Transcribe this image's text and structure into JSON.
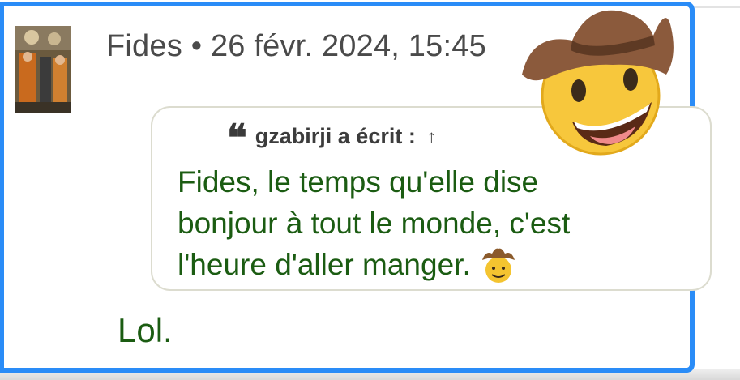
{
  "post": {
    "author": "Fides",
    "separator": "•",
    "date": "26 févr. 2024, 15:45",
    "quote": {
      "author_label": "gzabirji a écrit :",
      "jump_icon": "↑",
      "lines": [
        "Fides, le temps qu'elle dise",
        "bonjour à tout le monde, c'est",
        "l'heure d'aller manger."
      ],
      "emoji": "cowboy-face-emoji"
    },
    "reply": "Lol."
  },
  "colors": {
    "highlight_border": "#2a8cf7",
    "quote_text": "#1b5c12",
    "meta_text": "#4a4a4a"
  }
}
